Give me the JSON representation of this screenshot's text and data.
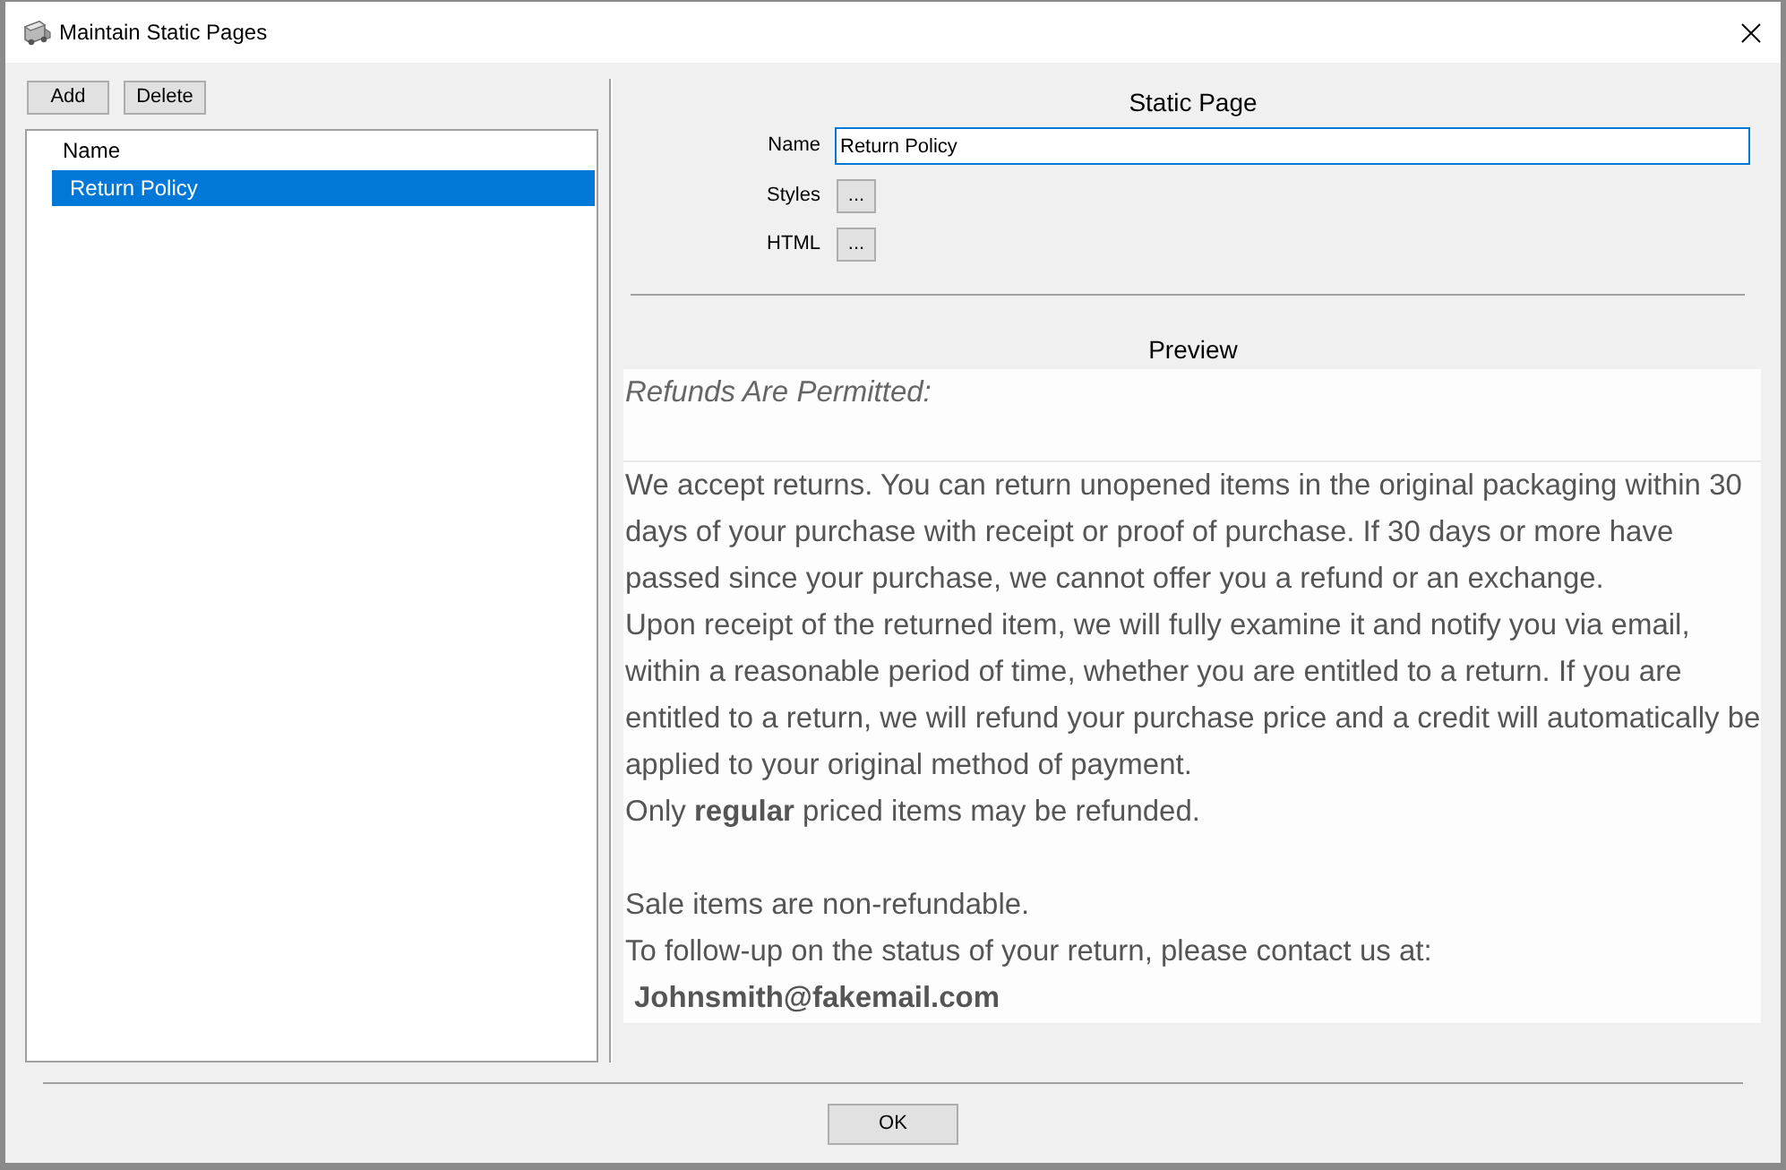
{
  "window": {
    "title": "Maintain Static Pages"
  },
  "toolbar": {
    "buttons": [
      "Add",
      "Delete"
    ]
  },
  "list": {
    "columns": [
      "Name"
    ],
    "rows": [
      {
        "name": "Return Policy",
        "selected": true
      }
    ]
  },
  "details": {
    "title": "Static Page",
    "fields": [
      {
        "label": "Name",
        "kind": "text",
        "value": "Return Policy",
        "focused": true
      },
      {
        "label": "Styles",
        "kind": "button",
        "button": "..."
      },
      {
        "label": "HTML",
        "kind": "button",
        "button": "..."
      }
    ]
  },
  "preview": {
    "title": "Preview",
    "blocks": [
      {
        "kind": "heading",
        "text": "Refunds Are Permitted:"
      },
      {
        "kind": "paragraph",
        "text": "We accept returns. You can return unopened items in the original packaging within 30 days of your purchase with receipt or proof of purchase. If 30 days or more have passed since your purchase, we cannot offer you a refund or an exchange."
      },
      {
        "kind": "paragraph",
        "text": "Upon receipt of the returned item, we will fully examine it and notify you via email, within a reasonable period of time, whether you are entitled to a return. If you are entitled to a return, we will refund your purchase price and a credit will automatically be applied to your original method of payment."
      },
      {
        "kind": "paragraph",
        "text": "Only **regular** priced items may be refunded."
      },
      {
        "kind": "blank"
      },
      {
        "kind": "paragraph",
        "text": "Sale items are non-refundable."
      },
      {
        "kind": "paragraph",
        "text": "To follow-up on the status of your return, please contact us at:"
      },
      {
        "kind": "email",
        "text": "Johnsmith@fakemail.com"
      }
    ]
  },
  "footer": {
    "buttons": [
      "OK"
    ]
  }
}
